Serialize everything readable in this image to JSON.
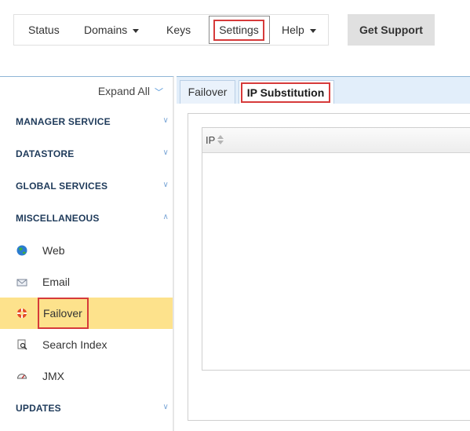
{
  "topnav": {
    "status": "Status",
    "domains": "Domains",
    "keys": "Keys",
    "settings": "Settings",
    "help": "Help"
  },
  "support": {
    "label": "Get Support"
  },
  "sidebar": {
    "expand_all": "Expand All",
    "sections": {
      "manager": "MANAGER SERVICE",
      "datastore": "DATASTORE",
      "global": "GLOBAL SERVICES",
      "misc": "MISCELLANEOUS",
      "updates": "UPDATES"
    },
    "items": {
      "web": "Web",
      "email": "Email",
      "failover": "Failover",
      "search": "Search Index",
      "jmx": "JMX"
    },
    "active_item": "Failover"
  },
  "tabs": {
    "failover": "Failover",
    "ip_substitution": "IP Substitution",
    "active": "IP Substitution"
  },
  "grid": {
    "columns": [
      "IP"
    ],
    "rows": []
  },
  "colors": {
    "highlight_border": "#d63a3a",
    "active_item_bg": "#fde28c",
    "section_text": "#1e3a5a",
    "tabbar_bg": "#e2eefa",
    "accent_chevron": "#4a90d6"
  },
  "icons": {
    "web": "globe-icon",
    "email": "envelope-icon",
    "failover": "lifebuoy-icon",
    "search": "search-index-icon",
    "jmx": "gauge-icon"
  }
}
